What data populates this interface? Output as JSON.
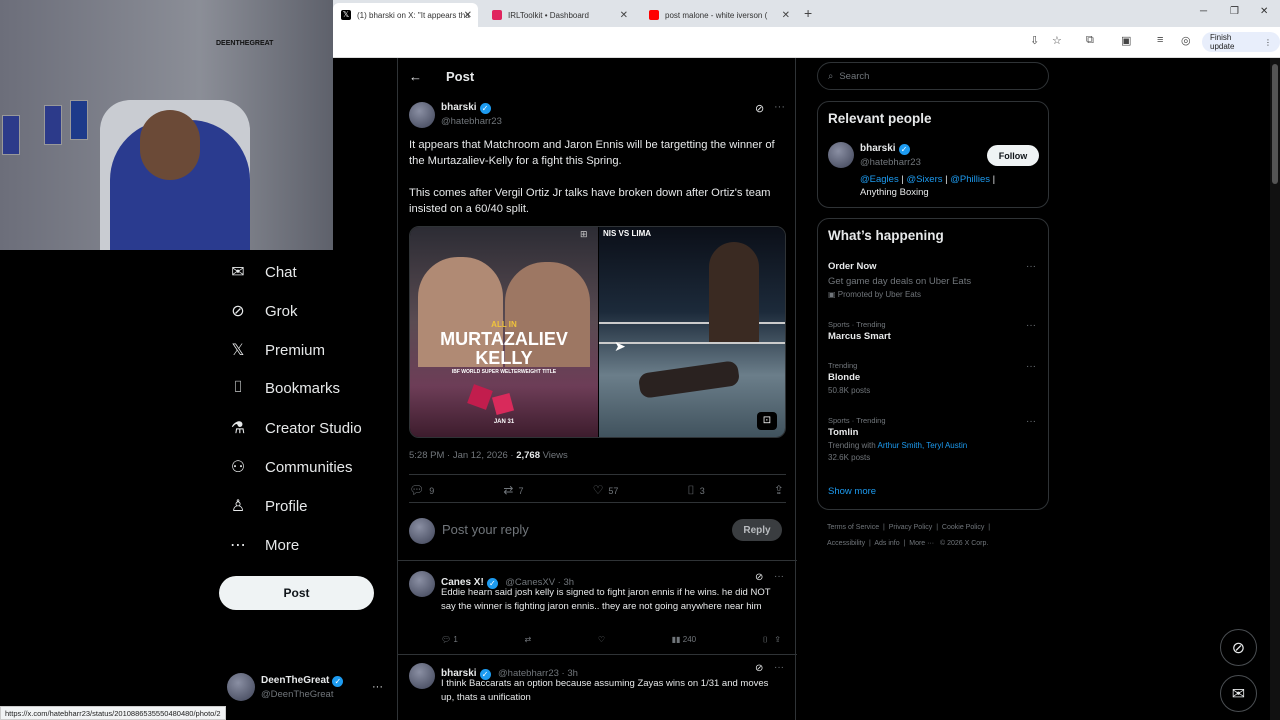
{
  "browser": {
    "tabs": [
      {
        "title": "(1) bharski on X: \"It appears tha",
        "favicon": "x-logo-icon"
      },
      {
        "title": "IRLToolkit • Dashboard",
        "favicon": "irltoolkit-icon"
      },
      {
        "title": "post malone - white iverson (",
        "favicon": "youtube-icon"
      }
    ],
    "finish_update": "Finish update",
    "status_url": "https://x.com/hatebharr23/status/2010886535550480480/photo/2"
  },
  "webcam": {
    "logo_text": "DEENTHEGREAT"
  },
  "nav": {
    "items": [
      {
        "label": "Chat",
        "icon": "mail-icon"
      },
      {
        "label": "Grok",
        "icon": "grok-icon"
      },
      {
        "label": "Premium",
        "icon": "x-icon"
      },
      {
        "label": "Bookmarks",
        "icon": "bookmark-icon"
      },
      {
        "label": "Creator Studio",
        "icon": "flask-icon"
      },
      {
        "label": "Communities",
        "icon": "people-icon"
      },
      {
        "label": "Profile",
        "icon": "person-icon"
      },
      {
        "label": "More",
        "icon": "more-circle-icon"
      }
    ],
    "post_label": "Post",
    "account": {
      "name": "DeenTheGreat",
      "handle": "@DeenTheGreat",
      "more": "···"
    }
  },
  "post": {
    "header_title": "Post",
    "author_name": "bharski",
    "author_handle": "@hatebharr23",
    "text_1": "It appears that Matchroom and Jaron Ennis will be targetting the winner of the Murtazaliev-Kelly for a fight this Spring.",
    "text_2": "This comes after Vergil Ortiz Jr talks have broken down after Ortiz's team insisted on a 60/40 split.",
    "media_left": {
      "top_text": "ALL IN",
      "title_1": "MURTAZALIEV",
      "title_2": "KELLY",
      "sub": "IBF WORLD SUPER WELTERWEIGHT TITLE",
      "date": "JAN 31"
    },
    "media_right": {
      "top_text": "NIS VS LIMA"
    },
    "timestamp": "5:28 PM · Jan 12, 2026 · ",
    "views_count": "2,768",
    "views_label": " Views",
    "actions": {
      "replies": "9",
      "reposts": "7",
      "likes": "57",
      "bookmarks": "3"
    },
    "reply_placeholder": "Post your reply",
    "reply_button": "Reply"
  },
  "comments": [
    {
      "name": "Canes X!",
      "handle": "@CanesXV · 3h",
      "text": "Eddie hearn said josh kelly is signed to fight jaron ennis if he wins. he did NOT say the winner is fighting jaron ennis.. they are not going anywhere near him",
      "replies": "1",
      "views": "240"
    },
    {
      "name": "bharski",
      "handle": "@hatebharr23 · 3h",
      "text": "I think Baccarats an option because assuming Zayas wins on 1/31 and moves up, thats a unification"
    }
  ],
  "right": {
    "search_placeholder": "Search",
    "relevant": {
      "title": "Relevant people",
      "name": "bharski",
      "handle": "@hatebharr23",
      "follow": "Follow",
      "bio_link_1": "@Eagles",
      "bio_sep_1": " | ",
      "bio_link_2": "@Sixers",
      "bio_sep_2": " | ",
      "bio_link_3": "@Phillies",
      "bio_sep_3": " |",
      "bio_tail": "Anything Boxing"
    },
    "happening": {
      "title": "What’s happening",
      "trends": [
        {
          "cat": "",
          "name": "Order Now",
          "sub": "Get game day deals on Uber Eats",
          "sub2": "Promoted by Uber Eats"
        },
        {
          "cat": "Sports · Trending",
          "name": "Marcus Smart",
          "sub": ""
        },
        {
          "cat": "Trending",
          "name": "Blonde",
          "sub": "50.8K posts"
        },
        {
          "cat": "Sports · Trending",
          "name": "Tomlin",
          "sub_prefix": "Trending with ",
          "sub_links": "Arthur Smith, Teryl Austin",
          "sub": "32.6K posts"
        }
      ],
      "show_more": "Show more"
    },
    "footer": {
      "line1": [
        "Terms of Service",
        "Privacy Policy",
        "Cookie Policy"
      ],
      "line2": [
        "Accessibility",
        "Ads info",
        "More ···",
        "© 2026 X Corp."
      ]
    }
  },
  "colors": {
    "accent": "#1d9bf0",
    "bg": "#000000",
    "border": "#2f3336",
    "muted": "#71767b"
  }
}
